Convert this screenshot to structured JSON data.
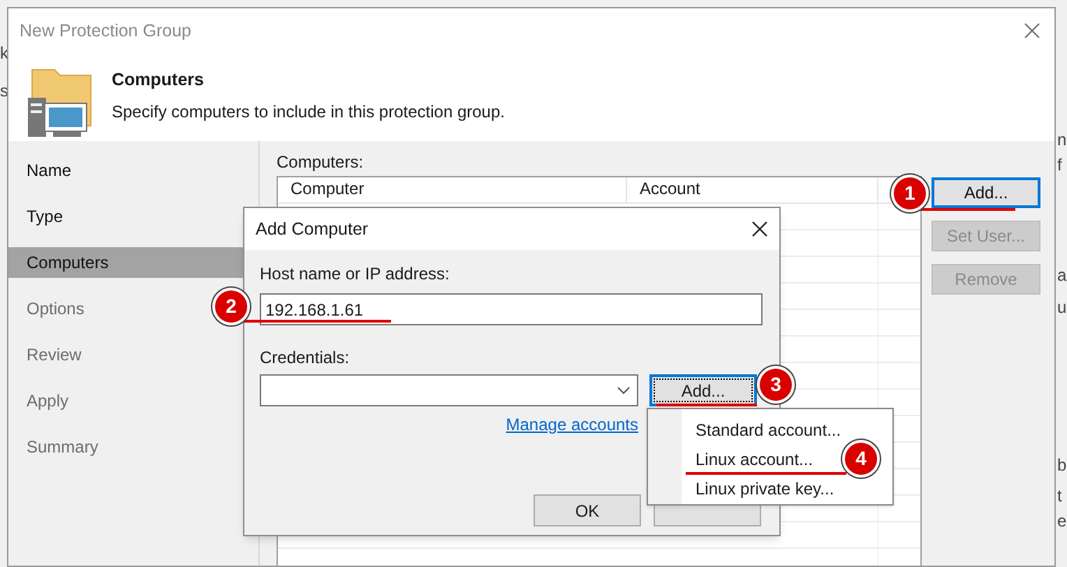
{
  "background": {
    "left_fragments": [
      "k",
      "s"
    ],
    "right_fragments": [
      "n",
      "f",
      "a",
      "u",
      "b",
      "t",
      "e"
    ]
  },
  "window": {
    "title": "New Protection Group",
    "header": {
      "title": "Computers",
      "subtitle": "Specify computers to include in this protection group."
    },
    "steps": [
      {
        "label": "Name",
        "selected": false,
        "disabled": false
      },
      {
        "label": "Type",
        "selected": false,
        "disabled": false
      },
      {
        "label": "Computers",
        "selected": true,
        "disabled": false
      },
      {
        "label": "Options",
        "selected": false,
        "disabled": true
      },
      {
        "label": "Review",
        "selected": false,
        "disabled": true
      },
      {
        "label": "Apply",
        "selected": false,
        "disabled": true
      },
      {
        "label": "Summary",
        "selected": false,
        "disabled": true
      }
    ],
    "computers_label": "Computers:",
    "table": {
      "columns": [
        "Computer",
        "Account"
      ]
    },
    "buttons": [
      {
        "label": "Add...",
        "disabled": false,
        "focused": true
      },
      {
        "label": "Set User...",
        "disabled": true,
        "focused": false
      },
      {
        "label": "Remove",
        "disabled": true,
        "focused": false
      }
    ]
  },
  "dialog": {
    "title": "Add Computer",
    "host_label": "Host name or IP address:",
    "host_value": "192.168.1.61",
    "credentials_label": "Credentials:",
    "add_button": "Add...",
    "manage_link": "Manage accounts",
    "ok_button": "OK"
  },
  "menu": {
    "items": [
      "Standard account...",
      "Linux account...",
      "Linux private key..."
    ]
  },
  "callouts": [
    {
      "number": "1"
    },
    {
      "number": "2"
    },
    {
      "number": "3"
    },
    {
      "number": "4"
    }
  ]
}
